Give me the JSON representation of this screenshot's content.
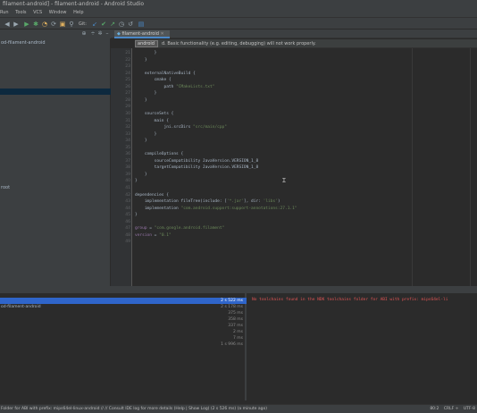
{
  "window": {
    "title": "filament-android] - filament-android - Android Studio"
  },
  "menu": [
    "Run",
    "Tools",
    "VCS",
    "Window",
    "Help"
  ],
  "toolbar": {
    "git_label": "Git:",
    "icons": [
      "back-arrow-icon",
      "forward-arrow-icon",
      "git-update-icon",
      "git-commit-icon",
      "git-push-icon",
      "history-icon",
      "revert-icon",
      "diff-icon"
    ]
  },
  "project": {
    "rows": [
      {
        "label": "od-filament-android"
      },
      {
        "label": "root"
      },
      {
        "label": "filament-android"
      }
    ]
  },
  "editor": {
    "tab_label": "filament-android",
    "banner_tag": "android",
    "banner_text": "d. Basic functionality (e.g. editing, debugging) will not work properly.",
    "lines": [
      {
        "n": "21",
        "segs": [
          {
            "t": "        }",
            "c": ""
          }
        ]
      },
      {
        "n": "22",
        "segs": [
          {
            "t": "    }",
            "c": ""
          }
        ]
      },
      {
        "n": "23",
        "segs": [
          {
            "t": "",
            "c": ""
          }
        ]
      },
      {
        "n": "24",
        "segs": [
          {
            "t": "    externalNativeBuild {",
            "c": ""
          }
        ]
      },
      {
        "n": "25",
        "segs": [
          {
            "t": "        cmake {",
            "c": ""
          }
        ]
      },
      {
        "n": "26",
        "segs": [
          {
            "t": "            path ",
            "c": ""
          },
          {
            "t": "\"CMakeLists.txt\"",
            "c": "str"
          }
        ]
      },
      {
        "n": "27",
        "segs": [
          {
            "t": "        }",
            "c": ""
          }
        ]
      },
      {
        "n": "28",
        "segs": [
          {
            "t": "    }",
            "c": ""
          }
        ]
      },
      {
        "n": "29",
        "segs": [
          {
            "t": "",
            "c": ""
          }
        ]
      },
      {
        "n": "30",
        "segs": [
          {
            "t": "    sourceSets {",
            "c": ""
          }
        ]
      },
      {
        "n": "31",
        "segs": [
          {
            "t": "        main {",
            "c": ""
          }
        ]
      },
      {
        "n": "32",
        "segs": [
          {
            "t": "            jni.srcDirs ",
            "c": ""
          },
          {
            "t": "\"src/main/cpp\"",
            "c": "str"
          }
        ]
      },
      {
        "n": "33",
        "segs": [
          {
            "t": "        }",
            "c": ""
          }
        ]
      },
      {
        "n": "34",
        "segs": [
          {
            "t": "    }",
            "c": ""
          }
        ]
      },
      {
        "n": "35",
        "segs": [
          {
            "t": "",
            "c": ""
          }
        ]
      },
      {
        "n": "36",
        "segs": [
          {
            "t": "    compileOptions {",
            "c": ""
          }
        ]
      },
      {
        "n": "37",
        "segs": [
          {
            "t": "        sourceCompatibility JavaVersion.VERSION_1_8",
            "c": ""
          }
        ]
      },
      {
        "n": "38",
        "segs": [
          {
            "t": "        targetCompatibility JavaVersion.VERSION_1_8",
            "c": ""
          }
        ]
      },
      {
        "n": "39",
        "segs": [
          {
            "t": "    }",
            "c": ""
          }
        ]
      },
      {
        "n": "40",
        "segs": [
          {
            "t": "}",
            "c": ""
          }
        ]
      },
      {
        "n": "41",
        "segs": [
          {
            "t": "",
            "c": ""
          }
        ]
      },
      {
        "n": "42",
        "segs": [
          {
            "t": "dependencies {",
            "c": ""
          }
        ]
      },
      {
        "n": "43",
        "segs": [
          {
            "t": "    implementation fileTree(include: [",
            "c": ""
          },
          {
            "t": "'*.jar'",
            "c": "str"
          },
          {
            "t": "], dir: ",
            "c": ""
          },
          {
            "t": "'libs'",
            "c": "str"
          },
          {
            "t": ")",
            "c": ""
          }
        ]
      },
      {
        "n": "44",
        "segs": [
          {
            "t": "    implementation ",
            "c": ""
          },
          {
            "t": "\"com.android.support:support-annotations:27.1.1\"",
            "c": "str"
          }
        ]
      },
      {
        "n": "45",
        "segs": [
          {
            "t": "}",
            "c": ""
          }
        ]
      },
      {
        "n": "46",
        "segs": [
          {
            "t": "",
            "c": ""
          }
        ]
      },
      {
        "n": "47",
        "segs": [
          {
            "t": "group",
            "c": "ident"
          },
          {
            "t": " = ",
            "c": ""
          },
          {
            "t": "\"com.google.android.filament\"",
            "c": "str"
          }
        ]
      },
      {
        "n": "48",
        "segs": [
          {
            "t": "version",
            "c": "ident"
          },
          {
            "t": " = ",
            "c": ""
          },
          {
            "t": "\"0.1\"",
            "c": "str"
          }
        ]
      },
      {
        "n": "49",
        "segs": [
          {
            "t": "",
            "c": ""
          }
        ]
      }
    ]
  },
  "build": {
    "rows": [
      {
        "label": "",
        "time": "2 s 522 ms",
        "selected": true
      },
      {
        "label": "od-filament-android",
        "time": "2 s 178 ms"
      },
      {
        "label": "",
        "time": "375 ms"
      },
      {
        "label": "",
        "time": "358 ms"
      },
      {
        "label": "",
        "time": "337 ms"
      },
      {
        "label": "",
        "time": "2 ms"
      },
      {
        "label": "",
        "time": "7 ms"
      },
      {
        "label": "",
        "time": "1 s 996 ms"
      }
    ],
    "error": "No toolchains found in the NDK toolchains folder for ABI with prefix: mips64el-li"
  },
  "status": {
    "message": "Folder for ABI with prefix: mips64el-linux-android // // Consult IDE log for more details (Help | Show Log) (2 s 526 ms) (a minute ago)",
    "position": "80:2",
    "line_sep": "CRLF ÷",
    "encoding": "UTF-8"
  },
  "colors": {
    "accent": "#4a88c7",
    "selection": "#2f65ca",
    "error": "#e05555",
    "string": "#6a8759",
    "keyword": "#cc7832"
  }
}
